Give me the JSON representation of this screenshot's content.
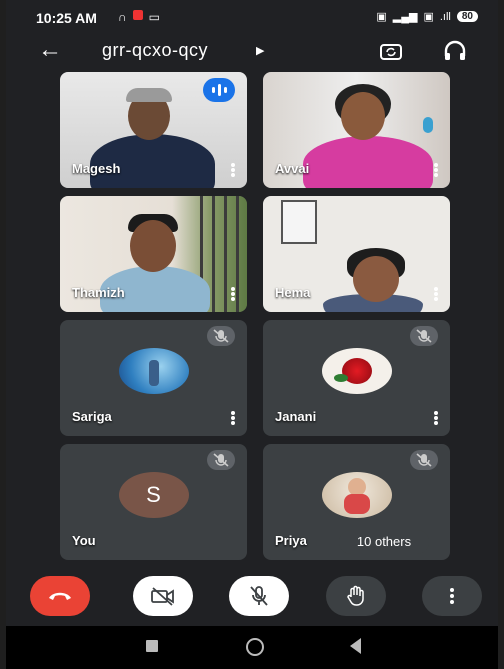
{
  "status_bar": {
    "time": "10:25 AM",
    "battery": "80",
    "signal_left": "4G",
    "signal_right": "4G"
  },
  "header": {
    "meeting_code": "grr-qcxo-qcy"
  },
  "tiles": [
    {
      "name": "Magesh",
      "type": "video",
      "speaking": true
    },
    {
      "name": "Avvai",
      "type": "video"
    },
    {
      "name": "Thamizh",
      "type": "video"
    },
    {
      "name": "Hema",
      "type": "video"
    },
    {
      "name": "Sariga",
      "type": "avatar",
      "muted": true
    },
    {
      "name": "Janani",
      "type": "avatar",
      "muted": true
    },
    {
      "name": "You",
      "type": "initial",
      "initial": "S",
      "muted": true
    },
    {
      "name": "Priya",
      "type": "avatar",
      "muted": true,
      "overflow_label": "10 others"
    }
  ],
  "colors": {
    "hangup": "#ea4335",
    "tile_bg": "#3c4043",
    "speaking": "#1a73e8",
    "initial_avatar": "#795548"
  },
  "icons": [
    "back-arrow-icon",
    "switch-camera-icon",
    "headphones-icon",
    "camera-off-icon",
    "mic-off-icon",
    "raise-hand-icon",
    "more-icon",
    "end-call-icon"
  ]
}
